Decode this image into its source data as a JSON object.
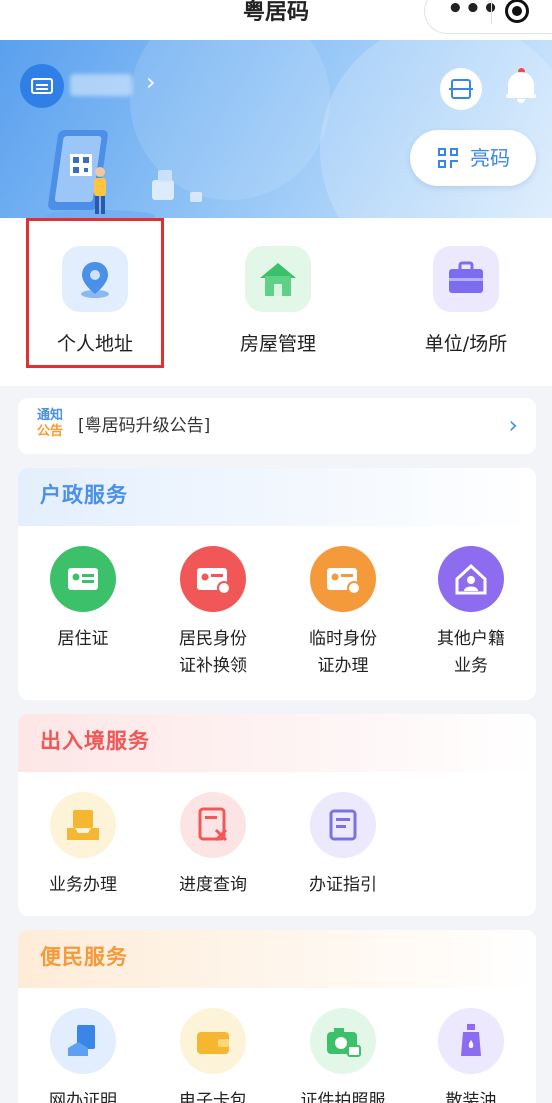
{
  "app": {
    "title": "粤居码",
    "more_glyph": "•••"
  },
  "banner": {
    "liang_label": "亮码",
    "user_chevron": "›",
    "icons": [
      "id-card-icon",
      "scan-icon",
      "bell-icon",
      "qr-code-icon"
    ]
  },
  "quick_entries": [
    {
      "label": "个人地址",
      "icon": "location-pin-icon",
      "highlighted": true
    },
    {
      "label": "房屋管理",
      "icon": "house-icon",
      "highlighted": false
    },
    {
      "label": "单位/场所",
      "icon": "briefcase-icon",
      "highlighted": false
    }
  ],
  "notice": {
    "tag_line1": "通知",
    "tag_line2": "公告",
    "text": "[粤居码升级公告]",
    "chevron": "›"
  },
  "sections": {
    "household": {
      "title": "户政服务",
      "title_color": "#4a8fe8",
      "items": [
        {
          "line1": "居住证",
          "line2": "",
          "icon": "residence-card-icon",
          "color": "#3cc06a"
        },
        {
          "line1": "居民身份",
          "line2": "证补换领",
          "icon": "id-card-replace-icon",
          "color": "#f25757"
        },
        {
          "line1": "临时身份",
          "line2": "证办理",
          "icon": "temporary-id-icon",
          "color": "#f59a3a"
        },
        {
          "line1": "其他户籍",
          "line2": "业务",
          "icon": "household-home-icon",
          "color": "#8e6cf0"
        }
      ]
    },
    "border": {
      "title": "出入境服务",
      "title_color": "#f25757",
      "items": [
        {
          "line1": "业务办理",
          "icon": "business-tray-icon",
          "color": "#f5b731"
        },
        {
          "line1": "进度查询",
          "icon": "progress-document-icon",
          "color": "#f25757"
        },
        {
          "line1": "办证指引",
          "icon": "guide-document-icon",
          "color": "#7b72e0"
        }
      ]
    },
    "convenience": {
      "title": "便民服务",
      "title_color": "#f59a3a",
      "items": [
        {
          "line1": "网办证明",
          "icon": "online-certificate-icon",
          "color": "#3a86e8"
        },
        {
          "line1": "电子卡包",
          "icon": "wallet-icon",
          "color": "#f5b731"
        },
        {
          "line1": "证件拍照服",
          "icon": "photo-camera-icon",
          "color": "#3cc06a"
        },
        {
          "line1": "散装油",
          "icon": "oil-bottle-icon",
          "color": "#8e6cf0"
        }
      ]
    }
  }
}
